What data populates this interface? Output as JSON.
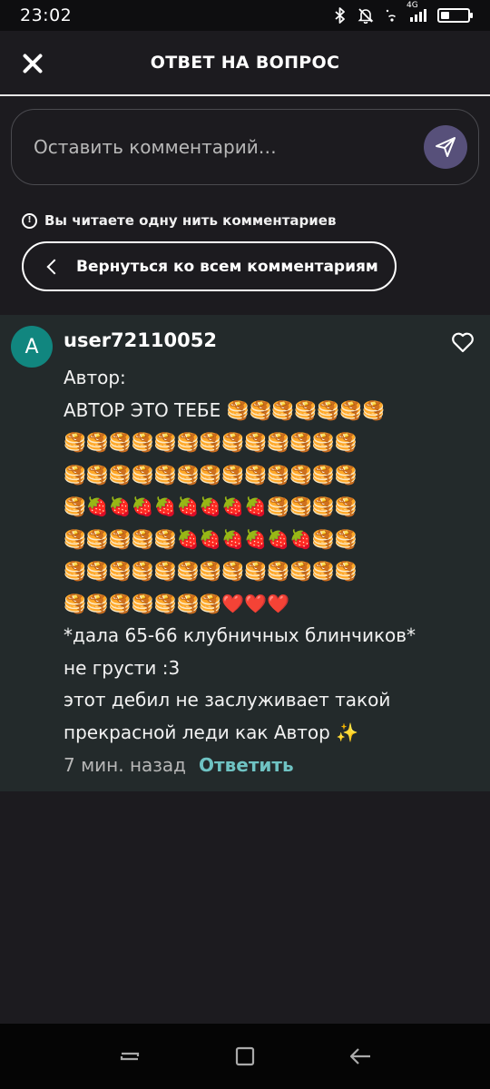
{
  "status_bar": {
    "time": "23:02",
    "signal_label": "4G",
    "icons": [
      "bluetooth-icon",
      "mute-icon",
      "wifi-icon",
      "signal-icon",
      "battery-icon"
    ]
  },
  "header": {
    "title": "ОТВЕТ НА ВОПРОС",
    "close_icon": "close-icon"
  },
  "comment_input": {
    "placeholder": "Оставить комментарий…",
    "send_icon": "send-icon",
    "accent": "#57507a"
  },
  "thread_note": {
    "text": "Вы читаете одну нить комментариев",
    "icon": "info-icon"
  },
  "back_button": {
    "label": "Вернуться ко всем комментариям"
  },
  "comment": {
    "avatar_letter": "A",
    "avatar_color": "#11867f",
    "username": "user72110052",
    "text": "Автор:\nАВТОР ЭТО ТЕБЕ 🥞🥞🥞🥞🥞🥞🥞\n🥞🥞🥞🥞🥞🥞🥞🥞🥞🥞🥞🥞🥞\n🥞🥞🥞🥞🥞🥞🥞🥞🥞🥞🥞🥞🥞\n🥞🍓🍓🍓🍓🍓🍓🍓🍓🥞🥞🥞🥞\n🥞🥞🥞🥞🥞🍓🍓🍓🍓🍓🍓🥞🥞\n🥞🥞🥞🥞🥞🥞🥞🥞🥞🥞🥞🥞🥞\n🥞🥞🥞🥞🥞🥞🥞❤️❤️❤️\n*дала 65-66 клубничных блинчиков*\nне грусти :3\nэтот дебил не заслуживает такой\nпрекрасной леди как Автор ✨",
    "timestamp": "7 мин. назад",
    "reply_label": "Ответить",
    "like_icon": "heart-icon",
    "reply_color": "#6fc3c3"
  },
  "nav_bar": {
    "buttons": [
      "recent-apps-icon",
      "home-icon",
      "back-icon"
    ]
  }
}
